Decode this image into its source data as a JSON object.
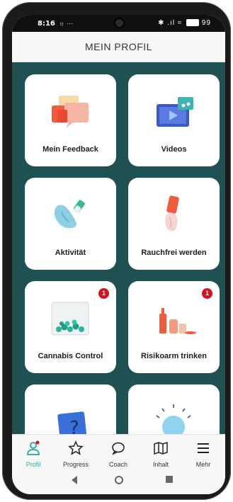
{
  "status_bar": {
    "time": "8:16",
    "extra": "☼ ···",
    "icons": "✱ .ıl ≈",
    "battery": "99"
  },
  "header": {
    "title": "MEIN PROFIL"
  },
  "cards": [
    {
      "label": "Mein Feedback",
      "icon": "feedback-illustration"
    },
    {
      "label": "Videos",
      "icon": "video-illustration"
    },
    {
      "label": "Aktivität",
      "icon": "activity-illustration"
    },
    {
      "label": "Rauchfrei werden",
      "icon": "smokefree-illustration"
    },
    {
      "label": "Cannabis Control",
      "icon": "cannabis-illustration",
      "badge": "1"
    },
    {
      "label": "Risikoarm trinken",
      "icon": "drinking-illustration",
      "badge": "1"
    },
    {
      "label": "",
      "icon": "question-illustration"
    },
    {
      "label": "",
      "icon": "idea-illustration"
    }
  ],
  "tabbar": {
    "items": [
      {
        "label": "Profil",
        "icon": "profile-icon",
        "active": true
      },
      {
        "label": "Progress",
        "icon": "star-icon"
      },
      {
        "label": "Coach",
        "icon": "chat-bubble-icon"
      },
      {
        "label": "Inhalt",
        "icon": "map-icon"
      },
      {
        "label": "Mehr",
        "icon": "menu-icon"
      }
    ]
  },
  "colors": {
    "background": "#1f5152",
    "accent": "#2aa39a",
    "badge": "#d90f1c"
  }
}
